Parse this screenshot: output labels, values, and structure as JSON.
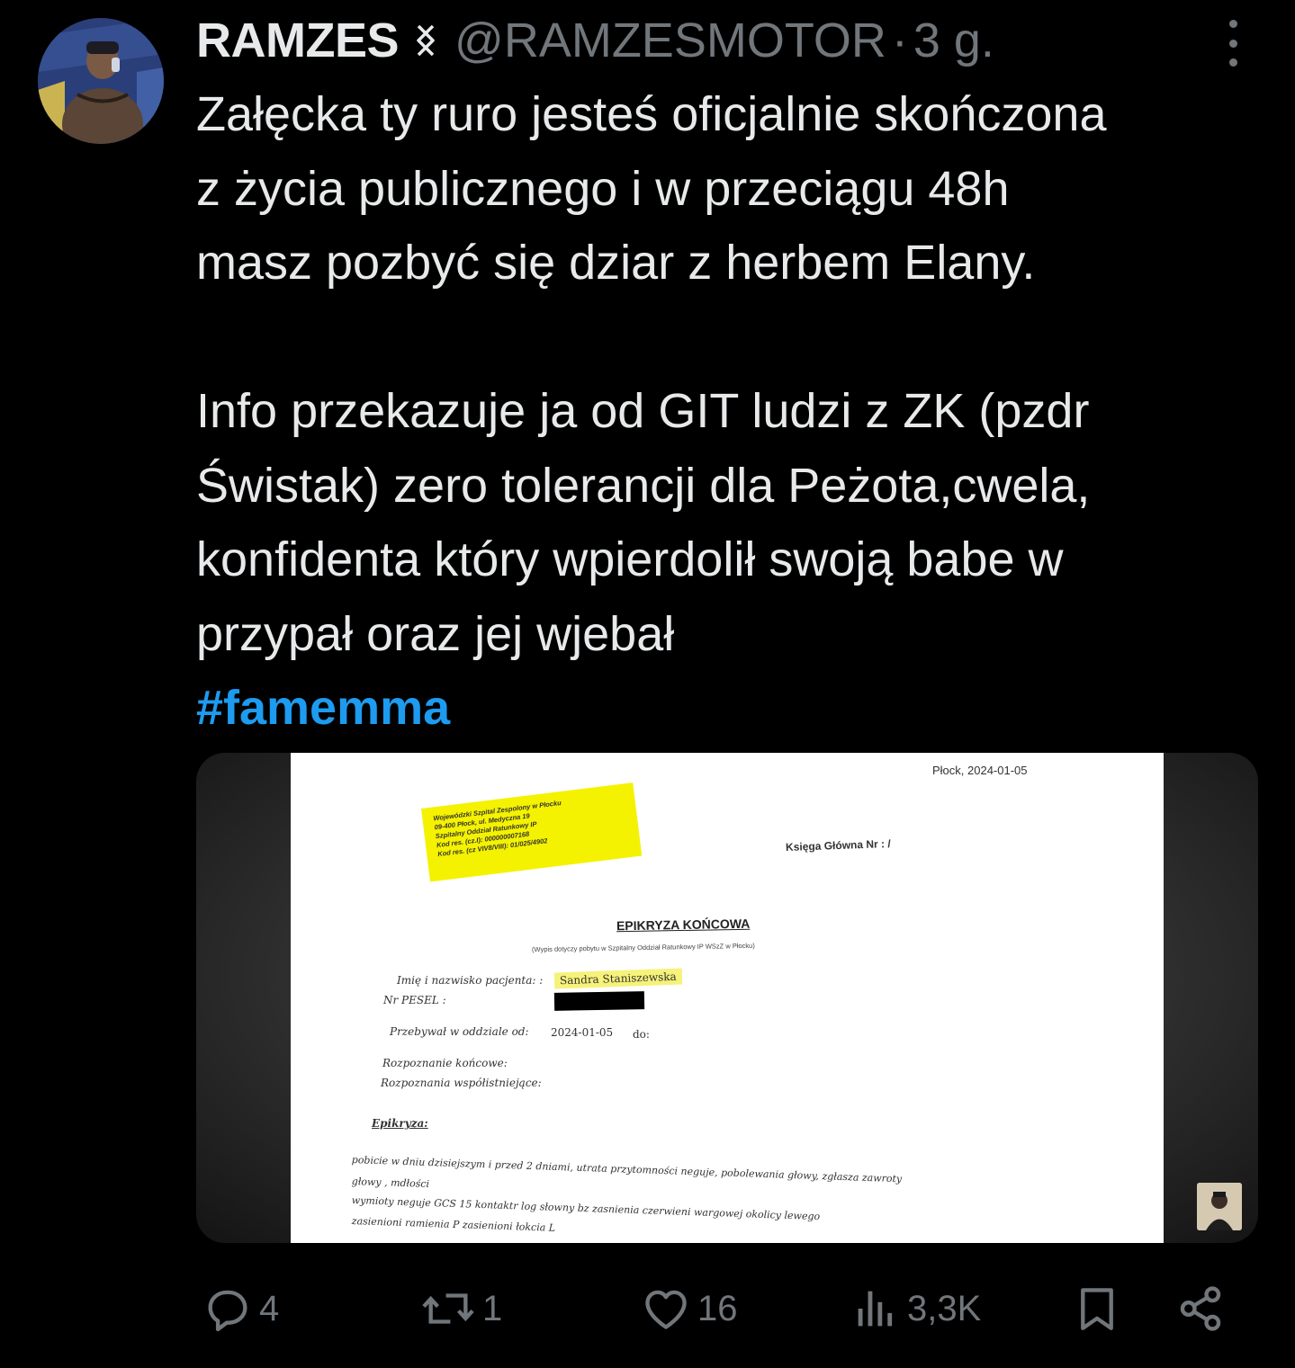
{
  "tweet": {
    "author_name": "RAMZES",
    "handle": "@RAMZESMOTOR",
    "separator": "·",
    "time": "3 g.",
    "lines": [
      "Załęcka ty ruro jesteś oficjalnie skończona",
      "z życia publicznego i w przeciągu 48h",
      "masz pozbyć się dziar z herbem Elany.",
      "",
      "Info przekazuje ja od GIT ludzi z ZK (pzdr",
      "Świstak) zero tolerancji dla Peżota,cwela,",
      "konfidenta który wpierdolił swoją babe w",
      "przypał oraz jej wjebał"
    ],
    "hashtag": "#famemma"
  },
  "media": {
    "city_date": "Płock, 2024-01-05",
    "stamp_lines": [
      "Wojewódzki Szpital Zespolony w Płocku",
      "09-400 Płock, ul. Medyczna 19",
      "Szpitalny Oddział Ratunkowy IP",
      "Kod res. (cz.I): 000000007168",
      "Kod res. (cz VIV8/VIII): 01/025/4902"
    ],
    "ksiega": "Księga Główna Nr :  /",
    "title": "EPIKRYZA KOŃCOWA",
    "subtitle": "(Wypis dotyczy pobytu w Szpitalny Oddział Ratunkowy IP WSzZ w Płocku)",
    "patient_label": "Imię i nazwisko pacjenta: :",
    "patient_value": "Sandra Staniszewska",
    "pesel_label": "Nr PESEL :",
    "stay_label": "Przebywał w oddziale od:",
    "stay_from": "2024-01-05",
    "stay_to_label": "do:",
    "diag_final_label": "Rozpoznanie końcowe:",
    "diag_other_label": "Rozpoznania współistniejące:",
    "epikryza_label": "Epikryza:",
    "body_lines": [
      "pobicie w dniu dzisiejszym i przed 2 dniami, utrata przytomności neguje, pobolewania głowy, zgłasza zawroty",
      "głowy , mdłości",
      "wymioty neguje GCS 15 kontaktr log słowny bz zasnienia czerwieni wargowej okolicy lewego",
      "zasienioni ramienia P zasienioni łokcia L"
    ]
  },
  "actions": {
    "replies": "4",
    "reposts": "1",
    "likes": "16",
    "views": "3,3K"
  },
  "colors": {
    "background": "#000000",
    "text": "#e7e9ea",
    "muted": "#71767b",
    "link": "#1d9bf0",
    "highlight": "#f4f200"
  },
  "icons": [
    "reply-icon",
    "repost-icon",
    "like-icon",
    "views-icon",
    "bookmark-icon",
    "share-icon",
    "more-icon",
    "badge-icon"
  ]
}
